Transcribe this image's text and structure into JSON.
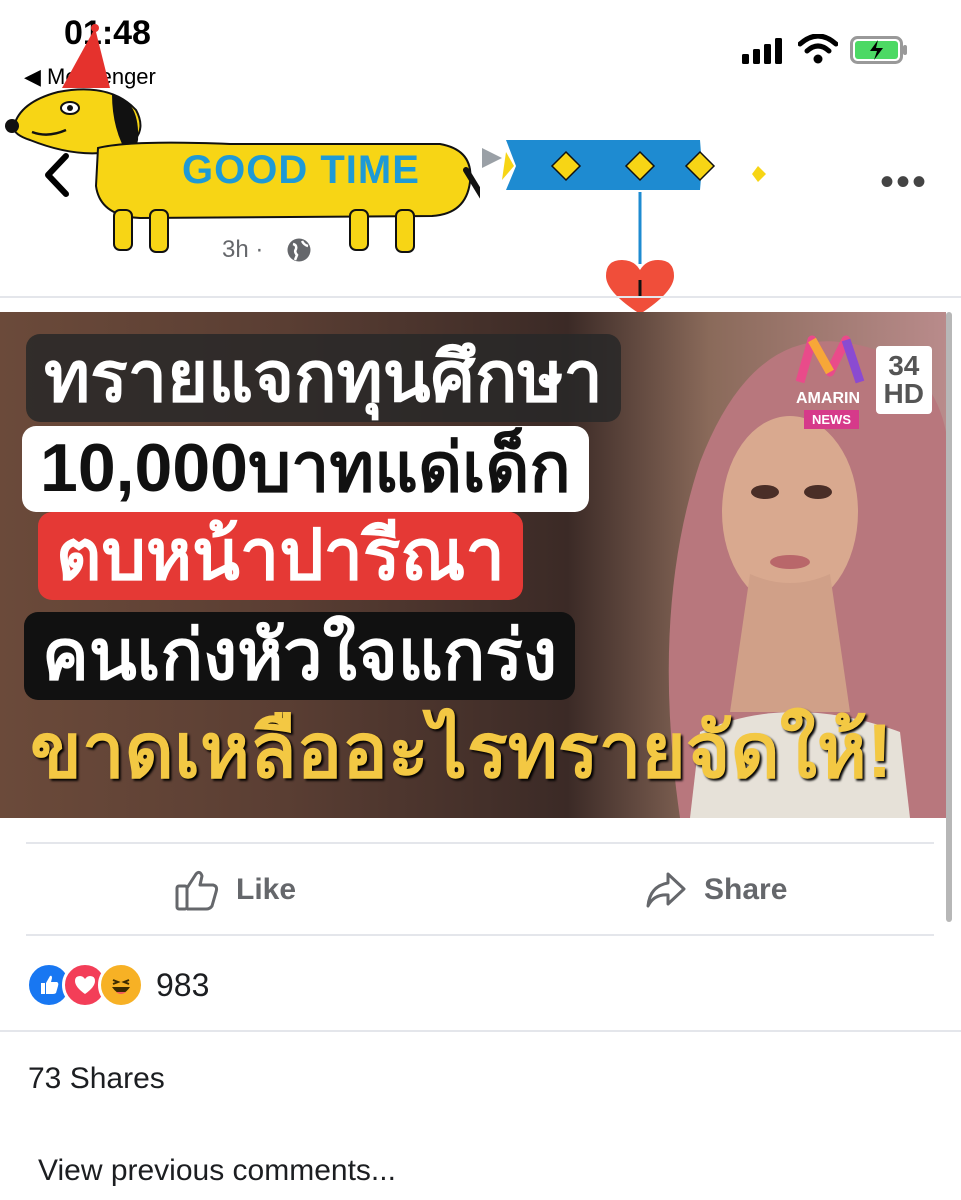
{
  "status_bar": {
    "time": "01:48",
    "back_to_app": "◀ Messenger"
  },
  "post": {
    "author": "",
    "time": "3h ·"
  },
  "stickers": {
    "goodtime": "GOOD TIME"
  },
  "media": {
    "headlines": [
      "ทรายแจกทุนศึกษา",
      "10,000บาทแด่เด็ก",
      "ตบหน้าปารีณา",
      "คนเก่งหัวใจแกร่ง",
      "ขาดเหลืออะไรทรายจัดให้!"
    ],
    "channel_name": "AMARIN",
    "channel_tag": "NEWS",
    "channel_number": "34",
    "channel_hd": "HD"
  },
  "actions": {
    "like": "Like",
    "share": "Share"
  },
  "reactions": {
    "count": "983",
    "types": [
      "like-icon",
      "love-icon",
      "haha-icon"
    ],
    "colors": {
      "like": "#1877f2",
      "love": "#f33e58",
      "haha": "#f7b125"
    }
  },
  "shares": "73 Shares",
  "comments": {
    "view_previous": "View previous comments..."
  }
}
